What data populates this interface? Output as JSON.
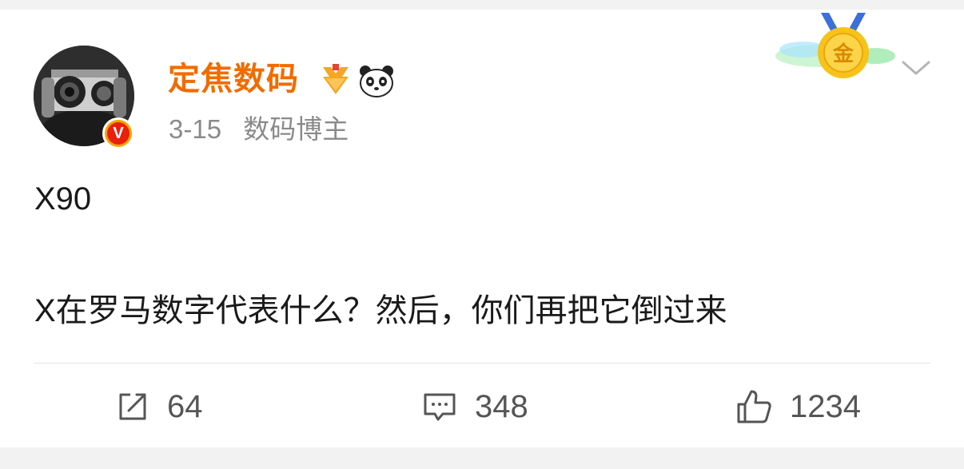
{
  "post": {
    "author": "定焦数码",
    "date": "3-15",
    "author_tag": "数码博主",
    "content_lines": [
      "X90",
      "X在罗马数字代表什么？然后，你们再把它倒过来"
    ],
    "medal_text": "金",
    "verified_mark": "V"
  },
  "actions": {
    "repost_count": "64",
    "comment_count": "348",
    "like_count": "1234"
  },
  "colors": {
    "author_name": "#f06c00",
    "meta_text": "#8a8a8a",
    "body_text": "#1a1a1a",
    "action_text": "#555555",
    "background": "#f2f2f2",
    "card": "#ffffff"
  },
  "icons": [
    "vip-badge-icon",
    "panda-badge-icon",
    "gold-medal-icon",
    "chevron-down-icon",
    "repost-icon",
    "comment-icon",
    "like-icon"
  ]
}
